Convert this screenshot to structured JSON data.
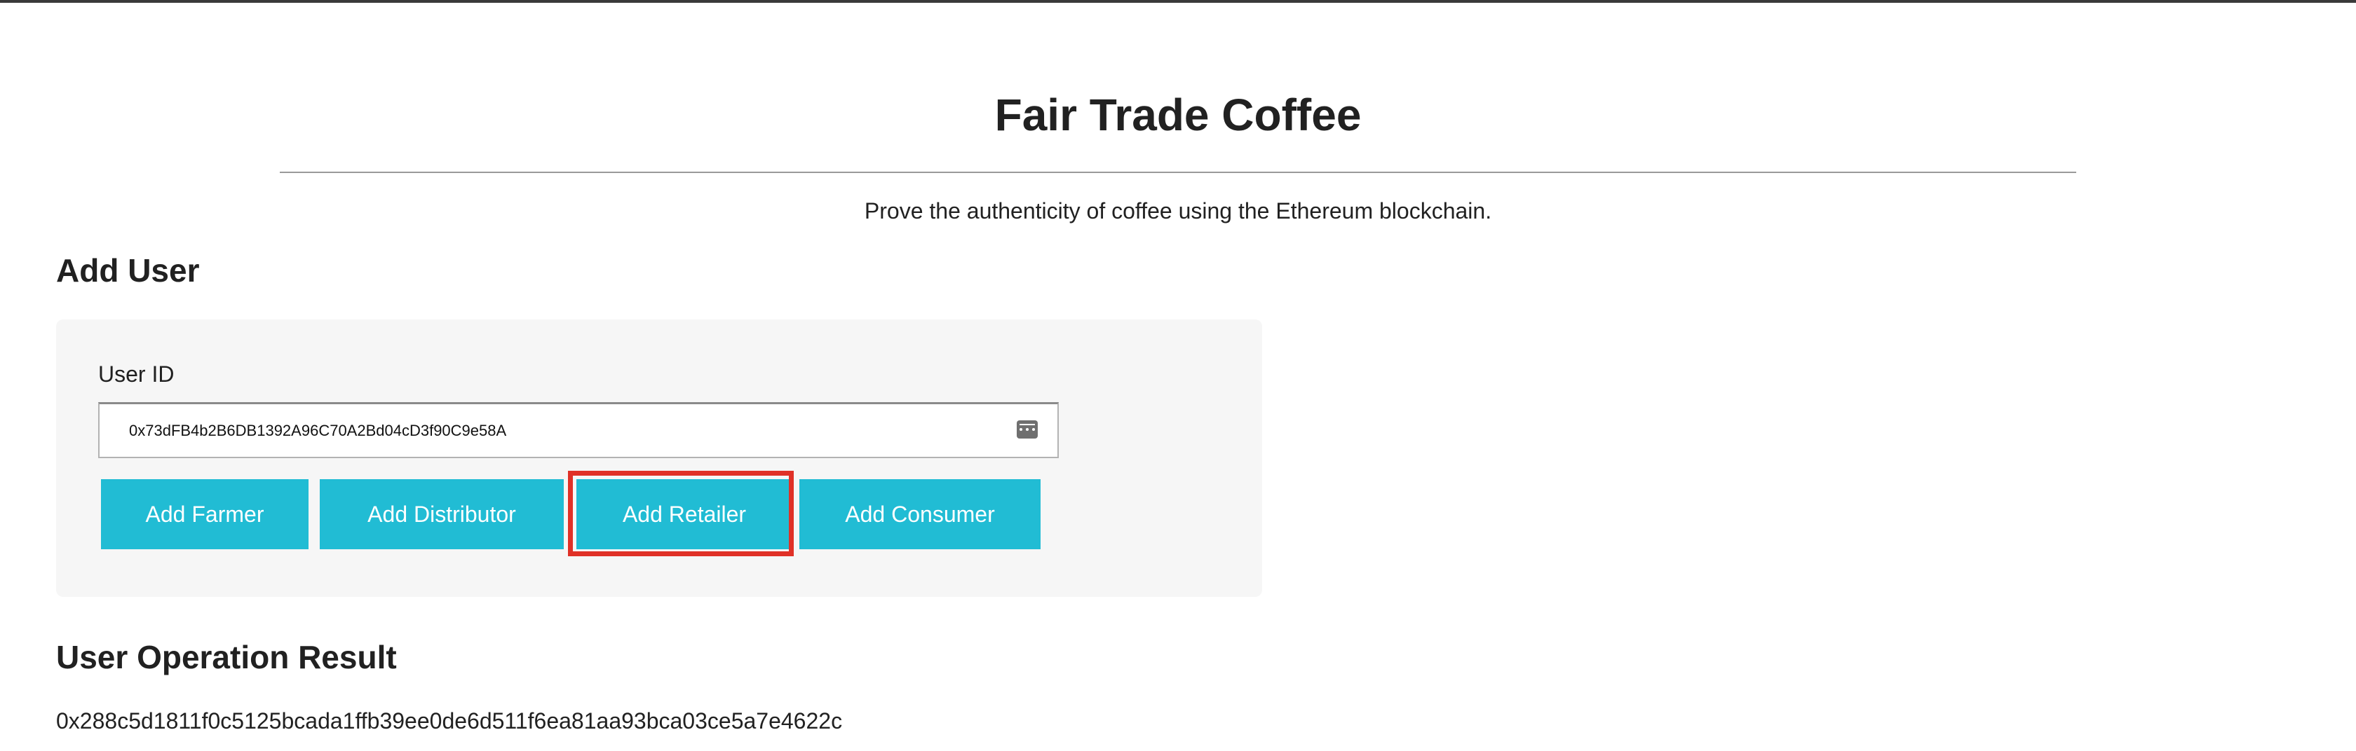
{
  "page": {
    "title": "Fair Trade Coffee",
    "tagline": "Prove the authenticity of coffee using the Ethereum blockchain."
  },
  "add_user": {
    "heading": "Add User",
    "user_id_label": "User ID",
    "user_id_value": "0x73dFB4b2B6DB1392A96C70A2Bd04cD3f90C9e58A",
    "buttons": {
      "add_farmer": "Add Farmer",
      "add_distributor": "Add Distributor",
      "add_retailer": "Add Retailer",
      "add_consumer": "Add Consumer"
    },
    "highlighted_button": "add_retailer"
  },
  "result": {
    "heading": "User Operation Result",
    "value": "0x288c5d1811f0c5125bcada1ffb39ee0de6d511f6ea81aa93bca03ce5a7e4622c"
  },
  "colors": {
    "button_bg": "#21bcd4",
    "highlight": "#e03127",
    "panel_bg": "#f6f6f6"
  },
  "icons": {
    "input_autofill": "autofill-icon"
  }
}
